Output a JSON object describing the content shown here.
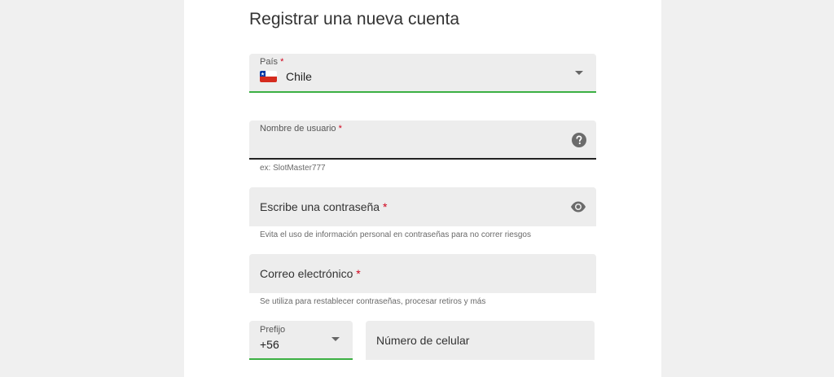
{
  "form": {
    "title": "Registrar una nueva cuenta",
    "required_mark": "*",
    "country": {
      "label": "País",
      "value": "Chile",
      "flag_icon": "chile-flag-icon",
      "underline_color": "#3cb043"
    },
    "username": {
      "label": "Nombre de usuario",
      "helper": "ex: SlotMaster777",
      "help_icon": "question-circle-icon"
    },
    "password": {
      "placeholder": "Escribe una contraseña",
      "helper": "Evita el uso de información personal en contraseñas para no correr riesgos",
      "toggle_icon": "eye-icon"
    },
    "email": {
      "placeholder": "Correo electrónico",
      "helper": "Se utiliza para restablecer contraseñas, procesar retiros y más"
    },
    "prefix": {
      "label": "Prefijo",
      "value": "+56"
    },
    "phone": {
      "placeholder": "Número de celular"
    }
  },
  "colors": {
    "accent_green": "#3cb043",
    "required_red": "#d0021b"
  }
}
